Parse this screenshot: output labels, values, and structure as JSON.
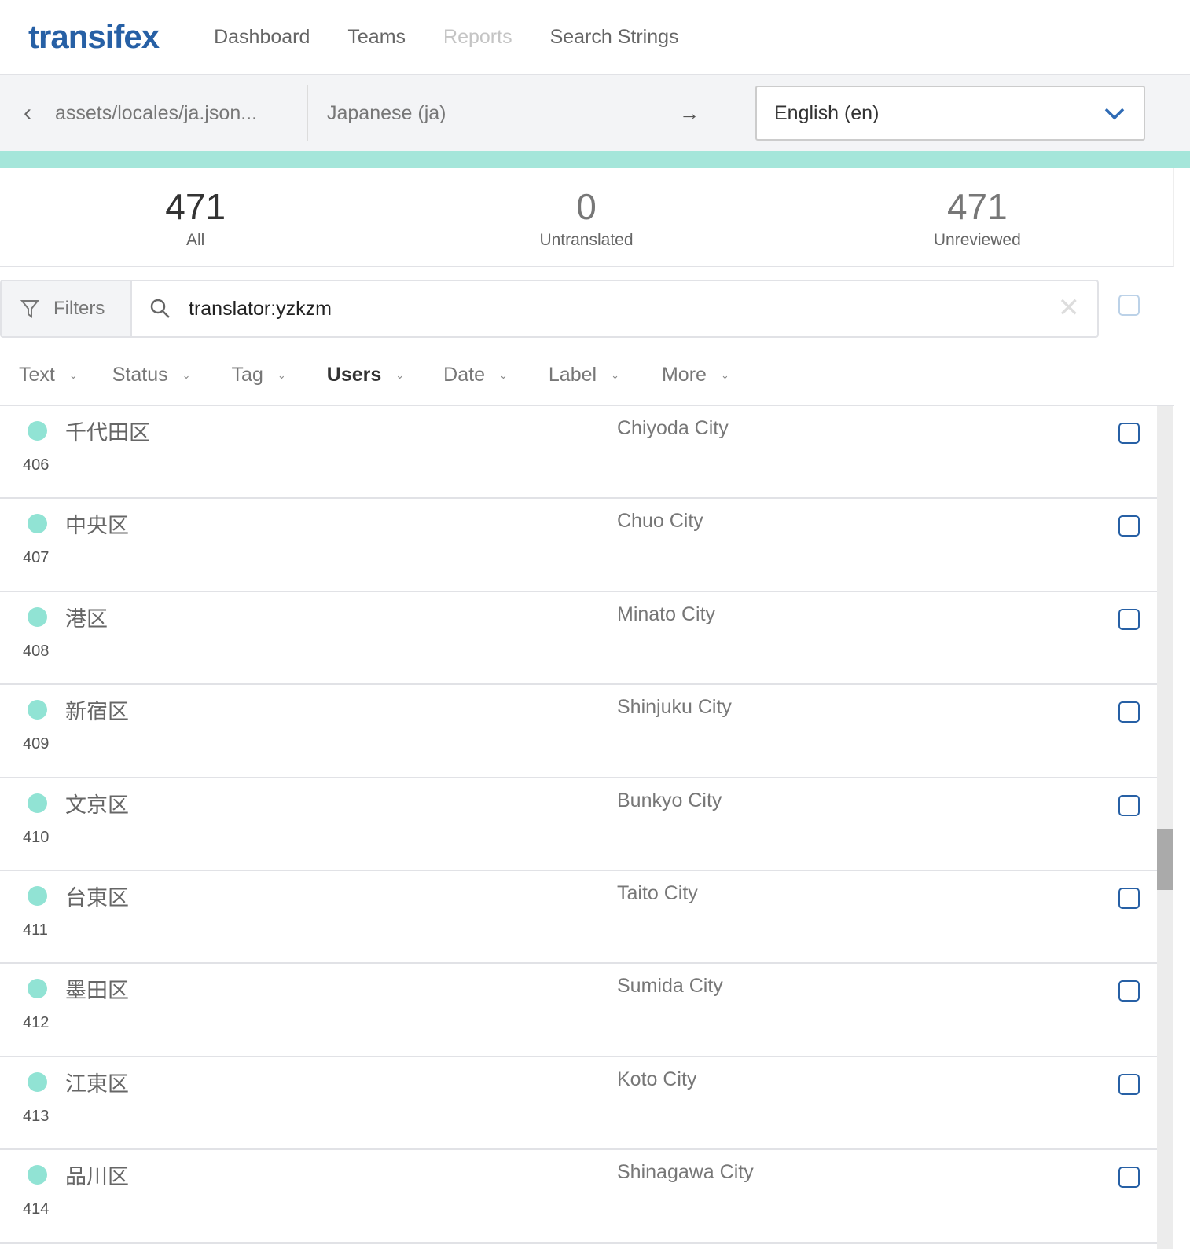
{
  "header": {
    "logo": "transifex",
    "nav": [
      "Dashboard",
      "Teams",
      "Reports",
      "Search Strings"
    ]
  },
  "context": {
    "file": "assets/locales/ja.json...",
    "source_language": "Japanese (ja)",
    "arrow": "→",
    "target_language": "English (en)"
  },
  "progress": {
    "translated_percent": 100,
    "color": "#a5e6da"
  },
  "stats": [
    {
      "count": "471",
      "label": "All"
    },
    {
      "count": "0",
      "label": "Untranslated"
    },
    {
      "count": "471",
      "label": "Unreviewed"
    }
  ],
  "search": {
    "filters_label": "Filters",
    "query": "translator:yzkzm"
  },
  "facets": [
    {
      "label": "Text"
    },
    {
      "label": "Status"
    },
    {
      "label": "Tag"
    },
    {
      "label": "Users",
      "active": true
    },
    {
      "label": "Date"
    },
    {
      "label": "Label"
    },
    {
      "label": "More"
    }
  ],
  "strings": [
    {
      "source": "千代田区",
      "id": "406",
      "translation": "Chiyoda City"
    },
    {
      "source": "中央区",
      "id": "407",
      "translation": "Chuo City"
    },
    {
      "source": "港区",
      "id": "408",
      "translation": "Minato City"
    },
    {
      "source": "新宿区",
      "id": "409",
      "translation": "Shinjuku City"
    },
    {
      "source": "文京区",
      "id": "410",
      "translation": "Bunkyo City"
    },
    {
      "source": "台東区",
      "id": "411",
      "translation": "Taito City"
    },
    {
      "source": "墨田区",
      "id": "412",
      "translation": "Sumida City"
    },
    {
      "source": "江東区",
      "id": "413",
      "translation": "Koto City"
    },
    {
      "source": "品川区",
      "id": "414",
      "translation": "Shinagawa City"
    }
  ],
  "colors": {
    "brand": "#2760a5",
    "status_dot": "#91e3d4"
  }
}
